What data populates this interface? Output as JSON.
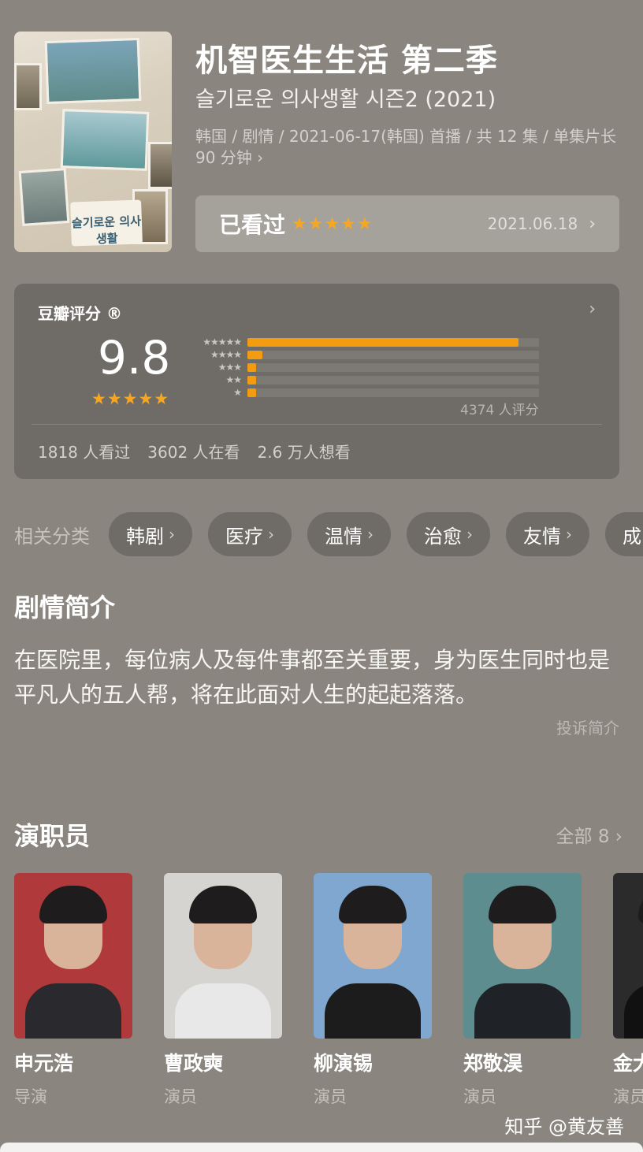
{
  "show": {
    "title": "机智医生生活 第二季",
    "original_title": "슬기로운 의사생활 시즌2 (2021)",
    "meta": "韩国 / 剧情 / 2021-06-17(韩国) 首播 / 共 12 集 / 单集片长 90 分钟 ›",
    "poster_text": "슬기로운\n의사생활"
  },
  "watched": {
    "label": "已看过",
    "stars": "★★★★★",
    "date": "2021.06.18",
    "chevron": "›"
  },
  "rating": {
    "title": "豆瓣评分 ®",
    "score": "9.8",
    "stars": "★★★★★",
    "rating_count": "4374 人评分",
    "distribution": [
      {
        "stars": "★★★★★",
        "fraction": 0.93
      },
      {
        "stars": "★★★★",
        "fraction": 0.05
      },
      {
        "stars": "★★★",
        "fraction": 0.02
      },
      {
        "stars": "★★",
        "fraction": 0.02
      },
      {
        "stars": "★",
        "fraction": 0.02
      }
    ],
    "stats": [
      "1818 人看过",
      "3602 人在看",
      "2.6 万人想看"
    ]
  },
  "categories": {
    "label": "相关分类",
    "tags": [
      "韩剧",
      "医疗",
      "温情",
      "治愈",
      "友情",
      "成"
    ]
  },
  "synopsis": {
    "heading": "剧情简介",
    "text": "在医院里，每位病人及每件事都至关重要，身为医生同时也是平凡人的五人帮，将在此面对人生的起起落落。",
    "report_label": "投诉简介"
  },
  "cast": {
    "heading": "演职员",
    "all_label": "全部 8 ›",
    "members": [
      {
        "name": "申元浩",
        "role": "导演",
        "bg": "#b0393b",
        "body": "#2a2a2e"
      },
      {
        "name": "曹政奭",
        "role": "演员",
        "bg": "#d6d4d0",
        "body": "#e8e8e8"
      },
      {
        "name": "柳演锡",
        "role": "演员",
        "bg": "#7fa7cf",
        "body": "#1c1c1c"
      },
      {
        "name": "郑敬淏",
        "role": "演员",
        "bg": "#5e8d8f",
        "body": "#1f2328"
      },
      {
        "name": "金大",
        "role": "演员",
        "bg": "#2b2b2b",
        "body": "#111111"
      }
    ]
  },
  "watermark": "知乎 @黄友善"
}
